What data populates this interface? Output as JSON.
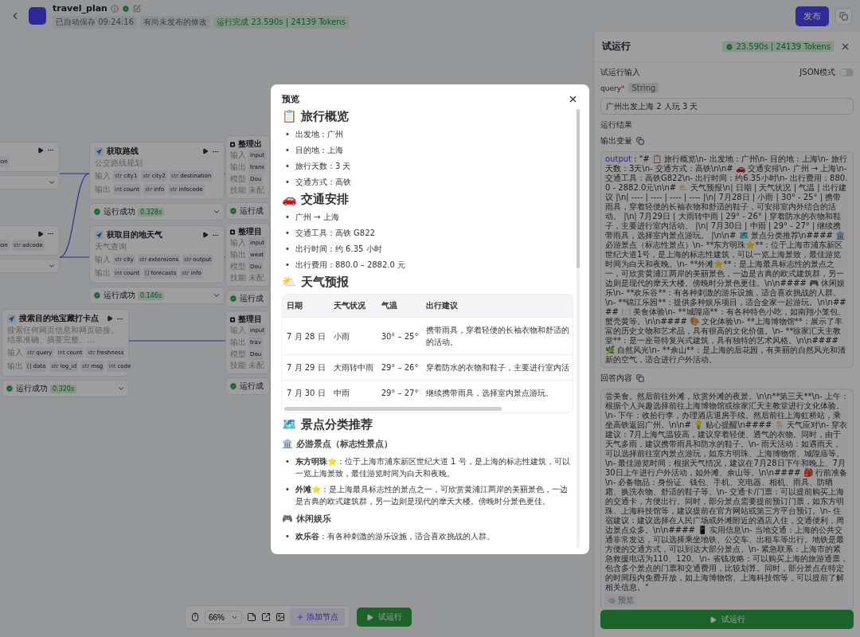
{
  "header": {
    "app_name": "travel_plan",
    "saved": "已自动保存 09:24:16",
    "unpublished": "有尚未发布的修改",
    "run_status": "运行完成 23.590s | 24139 Tokens",
    "publish": "发布"
  },
  "canvas": {
    "nodes": [
      {
        "kind": "plugin",
        "outputs": [
          {
            "name": "ion"
          }
        ]
      },
      {
        "kind": "plugin",
        "outputs": [
          {
            "name": "ion"
          },
          {
            "type": "str",
            "name": "adcode"
          }
        ]
      },
      {
        "kind": "plugin",
        "title": "搜索目的地宝藏打卡点",
        "input_label": "输入",
        "output_label": "输出",
        "description": "搜索任何网页信息和网页链接。结果准确、摘要完整。…",
        "inputs": [
          {
            "type": "str",
            "name": "query"
          },
          {
            "type": "int",
            "name": "count"
          },
          {
            "type": "str",
            "name": "freshness"
          }
        ],
        "outputs": [
          {
            "type": "[]",
            "name": "data"
          },
          {
            "type": "str",
            "name": "log_id"
          },
          {
            "type": "str",
            "name": "msg"
          },
          {
            "type": "int",
            "name": "code"
          }
        ],
        "status": "运行成功",
        "time": "0.320s"
      },
      {
        "kind": "plugin",
        "title": "获取路线",
        "input_label": "输入",
        "output_label": "输出",
        "description": "公交路线规划",
        "inputs": [
          {
            "type": "str",
            "name": "city1"
          },
          {
            "type": "str",
            "name": "city2"
          },
          {
            "type": "str",
            "name": "destination"
          }
        ],
        "outputs": [
          {
            "type": "int",
            "name": "count"
          },
          {
            "type": "str",
            "name": "info"
          },
          {
            "type": "str",
            "name": "infocode"
          }
        ],
        "status": "运行成功",
        "time": "0.328s"
      },
      {
        "kind": "plugin",
        "title": "获取目的地天气",
        "input_label": "输入",
        "output_label": "输出",
        "description": "天气查询",
        "inputs": [
          {
            "type": "str",
            "name": "city"
          },
          {
            "type": "str",
            "name": "extensions"
          },
          {
            "type": "str",
            "name": "output"
          }
        ],
        "outputs": [
          {
            "type": "int",
            "name": "count"
          },
          {
            "type": "[]",
            "name": "forecasts"
          },
          {
            "type": "str",
            "name": "info"
          }
        ],
        "status": "运行成功",
        "time": "0.146s"
      },
      {
        "kind": "llm",
        "title": "整理出",
        "rows": [
          {
            "label": "输入",
            "value": "input"
          },
          {
            "label": "输出",
            "value": "trans"
          },
          {
            "label": "模型",
            "value": "Dou"
          },
          {
            "label": "技能",
            "value": "未配",
            "kind": "text"
          }
        ],
        "status": "运行成"
      },
      {
        "kind": "llm",
        "title": "整理目",
        "rows": [
          {
            "label": "输入",
            "value": "input"
          },
          {
            "label": "输出",
            "value": "weat"
          },
          {
            "label": "模型",
            "value": "Dou"
          },
          {
            "label": "技能",
            "value": "未配",
            "kind": "text"
          }
        ],
        "status": "运行成"
      },
      {
        "kind": "llm",
        "title": "整理目",
        "rows": [
          {
            "label": "输入",
            "value": "input"
          },
          {
            "label": "输出",
            "value": "trav"
          },
          {
            "label": "模型",
            "value": "Dou"
          },
          {
            "label": "技能",
            "value": "未配",
            "kind": "text"
          }
        ],
        "status": "运行成"
      }
    ],
    "toolbar": {
      "zoom": "66%",
      "add_node": "添加节点",
      "run": "试运行"
    }
  },
  "test_run": {
    "title": "试运行",
    "badge": "23.590s | 24139 Tokens",
    "input_heading": "试运行输入",
    "json_mode": {
      "label": "JSON模式",
      "on": false
    },
    "query": {
      "name": "query",
      "required_mark": "*",
      "type": "String",
      "value": "广州出发上海 2 人玩 3 天"
    },
    "result_heading": "运行结果",
    "output": {
      "heading": "输出变量",
      "key": "output",
      "value": " : \"# 📋 旅行概览\\n- 出发地：广州\\n- 目的地：上海\\n- 旅行天数：3天\\n- 交通方式：高铁\\n\\n# 🚗 交通安排\\n- 广州 → 上海\\n- 交通工具：高铁G822\\n- 出行时间：约6.35小时\\n- 出行费用：880.0 - 2882.0元\\n\\n# ⛅ 天气预报\\n| 日期 | 天气状况 | 气温 | 出行建议 |\\n| ---- | ---- | ---- | ---- |\\n| 7月28日 | 小雨 | 30° - 25° | 携带雨具，穿着轻便的长袖衣物和舒适的鞋子，可安排室内外结合的活动。 |\\n| 7月29日 | 大雨转中雨 | 29° - 26° | 穿着防水的衣物和鞋子，主要进行室内活动。 |\\n| 7月30日 | 中雨 | 29° - 27° | 继续携带雨具，选择室内景点游玩。 |\\n\\n# 🗺️ 景点分类推荐\\n#### 🏛️ 必游景点（标志性景点）\\n- **东方明珠⭐**：位于上海市浦东新区世纪大道1号，是上海的标志性建筑，可以一览上海景致，最佳游览时间为白天和夜晚。\\n- **外滩⭐**：是上海最具标志性的景点之一，可欣赏黄浦江两岸的美丽景色，一边是古典的欧式建筑群，另一边则是现代的摩天大楼。傍晚时分景色更佳。\\n\\n#### 🎮 休闲娱乐\\n- **欢乐谷**：有各种刺激的游乐设施，适合喜欢挑战的人群。\\n- **锦江乐园**：提供多种娱乐项目，适合全家一起游玩。\\n\\n#### 🍽️ 美食体验\\n- **城隍庙**：有各种特色小吃，如南翔小笼包、蟹壳黄等。\\n\\n#### 🎨 文化体验\\n- **上海博物馆**：展示了丰富的历史文物和艺术品，具有很高的文化价值。\\n- **徐家汇天主教堂**：是一座哥特复兴式建筑，具有独特的艺术风格。\\n\\n#### 🌿 自然风光\\n- **佘山**：是上海的后花园，有美丽的自然风光和清新的空气，适合进行户外活动。"
    },
    "answer": {
      "heading": "回答内容",
      "value": "尝美食。然后前往外滩，欣赏外滩的夜景。\\n\\n**第三天**\\n- 上午：根据个人兴趣选择前往上海博物馆或徐家汇天主教堂进行文化体验。\\n- 下午：收拾行李，办理酒店退房手续。然后前往上海虹桥站，乘坐高铁返回广州。\\n\\n# 💡 贴心提醒\\n#### 🌦️ 天气应对\\n- 穿衣建议：7月上海气温较高，建议穿着轻便、透气的衣物。同时，由于天气多雨，建议携带雨具和防水的鞋子。\\n- 雨天活动：如遇雨天，可以选择前往室内景点游玩，如东方明珠、上海博物馆、城隍庙等。\\n- 最佳游览时间：根据天气情况，建议在7月28日下午和晚上、7月30日上午进行户外活动，如外滩、佘山等。\\n\\n#### 🎒 行前准备\\n- 必备物品：身份证、钱包、手机、充电器、相机、雨具、防晒霜、换洗衣物、舒适的鞋子等。\\n- 交通卡/门票：可以提前购买上海的交通卡，方便出行。同时，部分景点需要提前预订门票，如东方明珠、上海科技馆等，建议提前在官方网站或第三方平台预订。\\n- 住宿建议：建议选择在人民广场或外滩附近的酒店入住，交通便利，周边景点众多。\\n\\n#### 📱 实用信息\\n- 当地交通：上海的公共交通非常发达，可以选择乘坐地铁、公交车、出租车等出行。地铁是最方便的交通方式，可以到达大部分景点。\\n- 紧急联系：上海市的紧急救援电话为110、120。\\n- 省钱攻略：可以购买上海的旅游通票，包含多个景点的门票和交通费用，比较划算。同时，部分景点在特定的时间段内免费开放，如上海博物馆、上海科技馆等，可以提前了解相关信息。\"",
      "preview": "预览"
    },
    "run_button": "试运行"
  },
  "preview": {
    "title": "预览",
    "blocks": [
      {
        "kind": "h2",
        "text": "📋 旅行概览"
      },
      {
        "kind": "list",
        "bullet": "•",
        "items": [
          "出发地：广州",
          "目的地：上海",
          "旅行天数：3 天",
          "交通方式：高铁"
        ]
      },
      {
        "kind": "h2",
        "text": "🚗 交通安排"
      },
      {
        "kind": "list",
        "bullet": "•",
        "items": [
          "广州 → 上海",
          "交通工具：高铁 G822",
          "出行时间：约 6.35 小时",
          "出行费用：880.0 – 2882.0 元"
        ]
      },
      {
        "kind": "h2",
        "text": "⛅ 天气预报"
      },
      {
        "kind": "table",
        "columns": [
          "日期",
          "天气状况",
          "气温",
          "出行建议"
        ],
        "rows": [
          [
            "7 月 28 日",
            "小雨",
            "30° – 25°",
            [
              "携带雨具，穿着轻便的长袖衣物和舒适的",
              "的活动。"
            ]
          ],
          [
            "7 月 29 日",
            "大雨转中雨",
            "29° – 26°",
            [
              "穿着防水的衣物和鞋子，主要进行室内活"
            ]
          ],
          [
            "7 月 30 日",
            "中雨",
            "29° – 27°",
            [
              "继续携带雨具，选择室内景点游玩。"
            ]
          ]
        ]
      },
      {
        "kind": "h2",
        "text": "🗺️ 景点分类推荐"
      },
      {
        "kind": "h3",
        "text": "🏛️ 必游景点（标志性景点）"
      },
      {
        "kind": "list",
        "bullet": "•",
        "items": [
          "**东方明珠⭐**：位于上海市浦东新区世纪大道 1 号，是上海的标志性建筑，可以一览上海景致，最佳游览时间为白天和夜晚。",
          "**外滩⭐**：是上海最具标志性的景点之一，可欣赏黄浦江两岸的美丽景色，一边是古典的欧式建筑群，另一边则是现代的摩天大楼。傍晚时分景色更佳。"
        ]
      },
      {
        "kind": "h3",
        "text": "🎮 休闲娱乐"
      },
      {
        "kind": "list",
        "bullet": "•",
        "items": [
          "**欢乐谷**：有各种刺激的游乐设施，适合喜欢挑战的人群。"
        ]
      }
    ]
  }
}
